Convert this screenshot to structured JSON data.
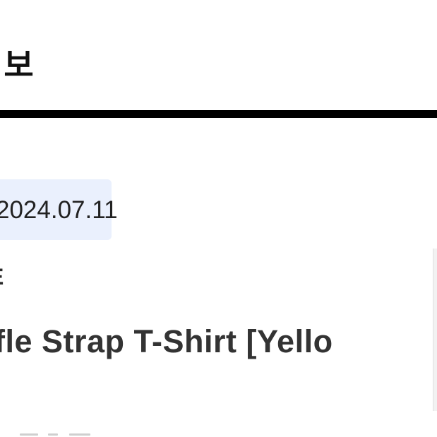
{
  "header": {
    "title": "정보"
  },
  "item": {
    "date": "2024.07.11",
    "brand": "E",
    "name": "fle Strap T-Shirt [Yello"
  }
}
